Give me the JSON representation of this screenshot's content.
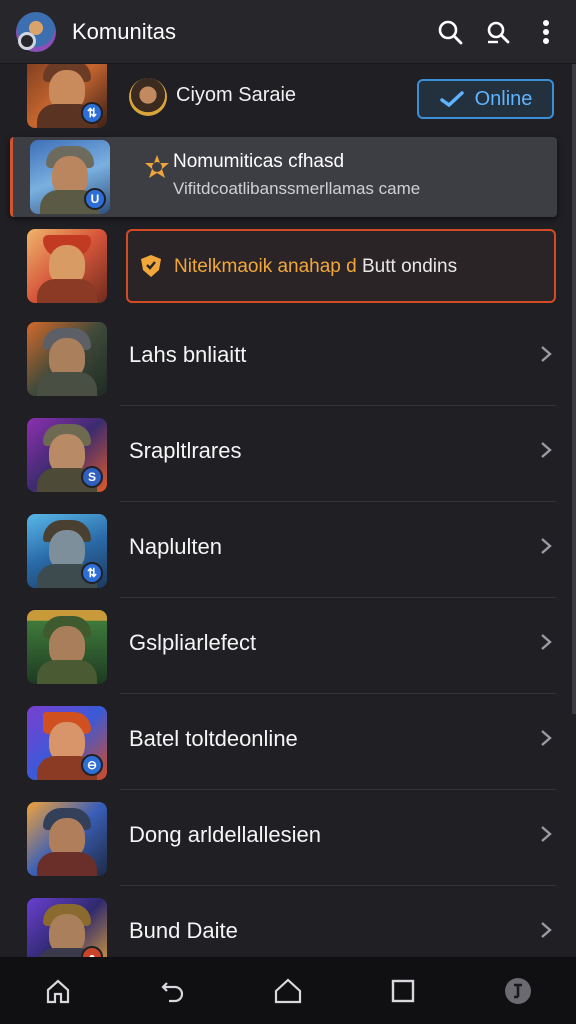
{
  "app_bar": {
    "title": "Komunitas",
    "icons": [
      "search-icon",
      "search-square-icon",
      "more-vert-icon"
    ]
  },
  "featured": {
    "player_name": "Ciyom Saraie",
    "online_button": "Online"
  },
  "highlight_card": {
    "title": "Nomumiticas cfhasd",
    "subtitle": "Vifitdcoatlibanssmerllamas came"
  },
  "outline_card": {
    "text_accent": "Nitelkmaoik anahap d",
    "text_tail": "Butt ondins"
  },
  "list": [
    {
      "label": "Lahs bnliaitt",
      "badge": ""
    },
    {
      "label": "Srapltlrares",
      "badge": "S"
    },
    {
      "label": "Naplulten",
      "badge": "⇅"
    },
    {
      "label": "Gslpliarlefect",
      "badge": ""
    },
    {
      "label": "Batel toltdeonline",
      "badge": "⊖"
    },
    {
      "label": "Dong arldellallesien",
      "badge": ""
    },
    {
      "label": "Bund Daite",
      "badge": "●"
    }
  ],
  "nav": [
    "home-icon",
    "back-icon",
    "house-icon",
    "recents-icon",
    "profile-icon"
  ],
  "colors": {
    "background": "#1f1f24",
    "accent_blue": "#3a8fd6",
    "accent_orange": "#d24b25",
    "text_orange": "#f2a73b"
  }
}
